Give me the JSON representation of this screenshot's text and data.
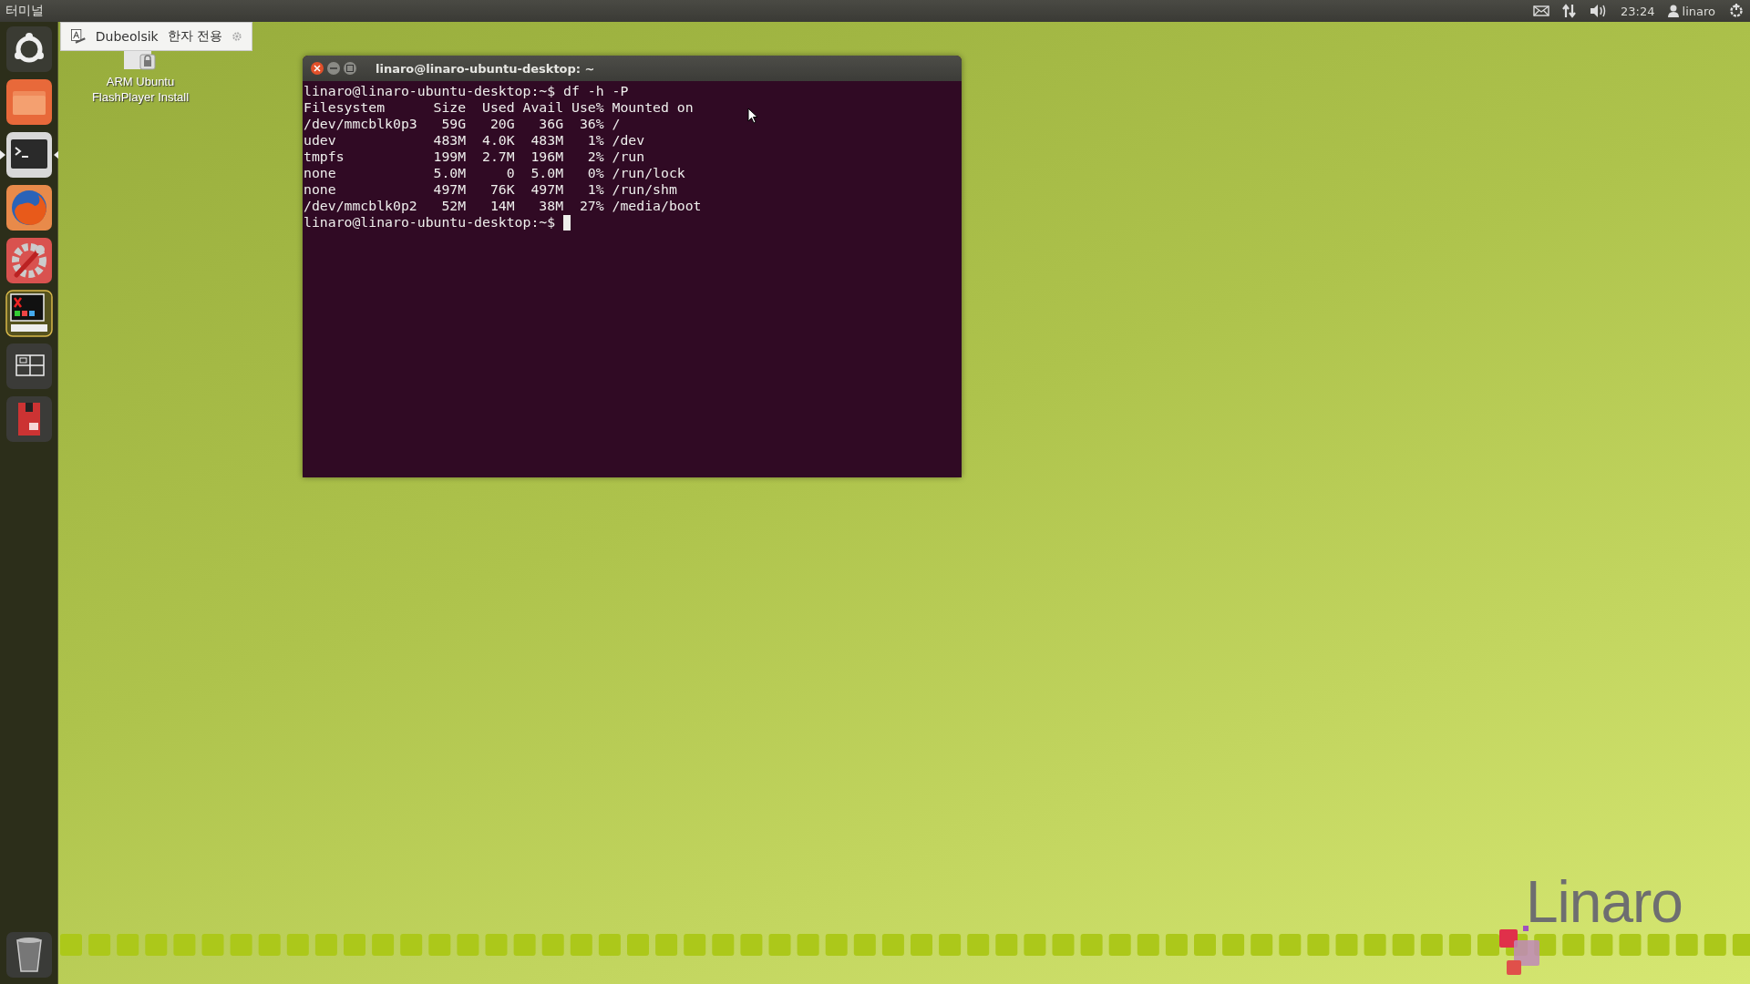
{
  "top_panel": {
    "app_name": "터미널",
    "clock": "23:24",
    "user": "linaro"
  },
  "launcher": {
    "items": [
      {
        "kind": "dash",
        "active": false
      },
      {
        "kind": "files",
        "active": false
      },
      {
        "kind": "terminal",
        "active": true
      },
      {
        "kind": "browser",
        "active": false
      },
      {
        "kind": "settings",
        "active": false
      },
      {
        "kind": "xterm",
        "active": false
      },
      {
        "kind": "workspaces",
        "active": false
      },
      {
        "kind": "sdcard",
        "active": false
      }
    ],
    "trash": {
      "kind": "trash"
    }
  },
  "input_method_bar": {
    "layout": "Dubeolsik",
    "mode": "한자 전용"
  },
  "desktop_icons": [
    {
      "label": "ARM Ubuntu FlashPlayer Install"
    }
  ],
  "terminal": {
    "title": "linaro@linaro-ubuntu-desktop: ~",
    "lines": [
      "linaro@linaro-ubuntu-desktop:~$ df -h -P",
      "Filesystem      Size  Used Avail Use% Mounted on",
      "/dev/mmcblk0p3   59G   20G   36G  36% /",
      "udev            483M  4.0K  483M   1% /dev",
      "tmpfs           199M  2.7M  196M   2% /run",
      "none            5.0M     0  5.0M   0% /run/lock",
      "none            497M   76K  497M   1% /run/shm",
      "/dev/mmcblk0p2   52M   14M   38M  27% /media/boot"
    ],
    "prompt": "linaro@linaro-ubuntu-desktop:~$ "
  },
  "wallpaper": {
    "logo": "Linaro"
  }
}
